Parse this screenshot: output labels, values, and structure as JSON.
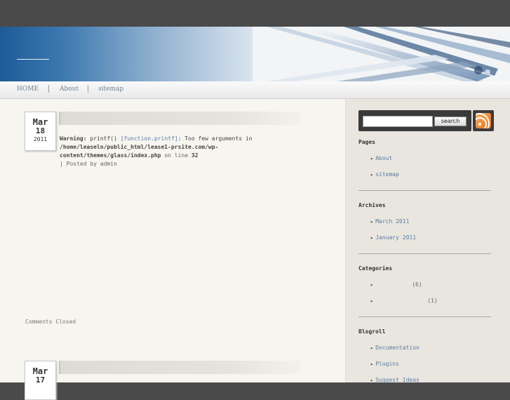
{
  "nav": {
    "home": "HOME",
    "about": "About",
    "sitemap": "sitemap"
  },
  "posts": [
    {
      "month": "Mar",
      "day": "18",
      "year": "2011",
      "warning_label": "Warning:",
      "warning_func": "printf()",
      "warning_link": "[function.printf]",
      "warning_msg": ": Too few arguments in",
      "warning_path": "/home/leaseln/public_html/lease1-prsite.com/wp-content/themes/glass/index.php",
      "warning_online": "on line",
      "warning_line": "32",
      "posted_by": "| Posted by admin",
      "comments": "Comments Closed"
    },
    {
      "month": "Mar",
      "day": "17"
    }
  ],
  "search": {
    "button": "search"
  },
  "icons": {
    "rss": "rss-feed-icon",
    "bullet": "arrow-bullet-icon"
  },
  "sidebar": {
    "pages": {
      "title": "Pages",
      "items": [
        "About",
        "sitemap"
      ]
    },
    "archives": {
      "title": "Archives",
      "items": [
        "March 2011",
        "January 2011"
      ]
    },
    "categories": {
      "title": "Categories",
      "counts": [
        "(6)",
        "(1)"
      ]
    },
    "blogroll": {
      "title": "Blogroll",
      "items": [
        "Documentation",
        "Plugins",
        "Suggest Ideas"
      ]
    }
  },
  "colors": {
    "link": "#5b7ba4",
    "header_blue": "#1e5a96",
    "content_bg": "#f7f5ef",
    "sidebar_bg": "#e9e6df"
  }
}
